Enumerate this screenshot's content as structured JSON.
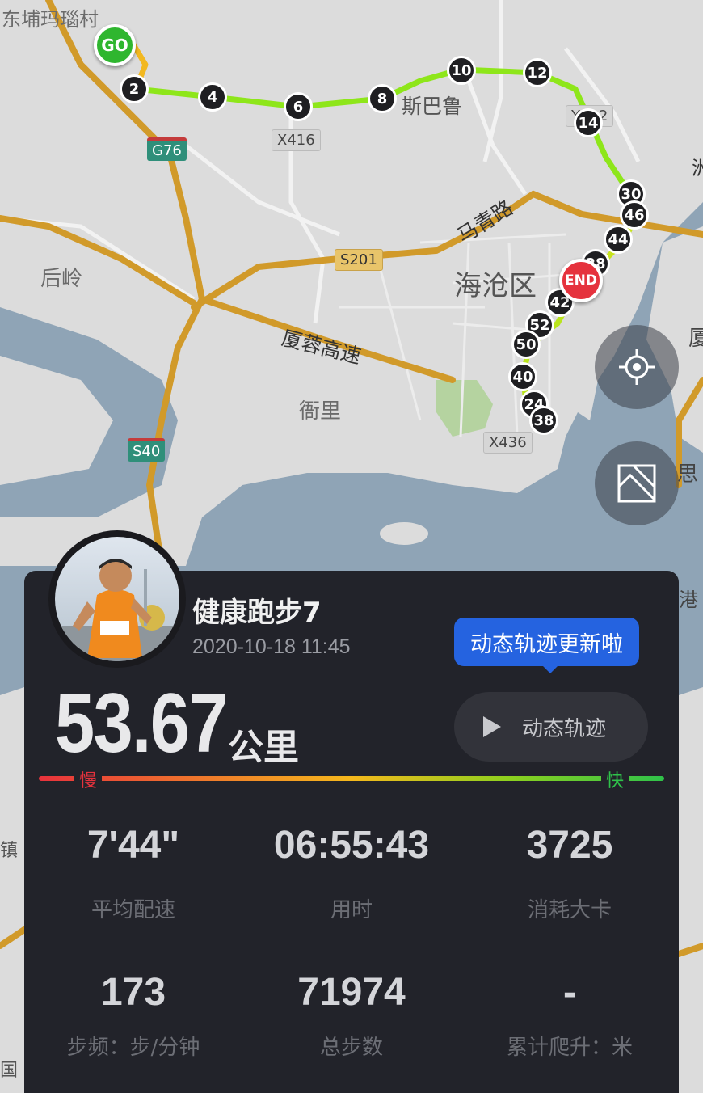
{
  "map": {
    "labels": {
      "top_left_village": "东埔玛瑙村",
      "houling": "后岭",
      "haicang": "海沧区",
      "hengli": "衙里",
      "siba": "斯巴鲁",
      "maqing_road": "马青路",
      "xiarong_expressway": "厦蓉高速",
      "edge_right_1": "洲",
      "edge_right_2": "厦",
      "edge_right_3": "思",
      "edge_right_4": "港",
      "edge_left_1": "镇",
      "edge_left_2": "国"
    },
    "road_signs": {
      "g76": "G76",
      "x416": "X416",
      "s201": "S201",
      "s40": "S40",
      "x436": "X436",
      "y012": "Y012"
    },
    "start_label": "GO",
    "end_label": "END",
    "km_markers": [
      "2",
      "4",
      "6",
      "8",
      "10",
      "12",
      "14",
      "30",
      "46",
      "44",
      "28",
      "42",
      "52",
      "50",
      "40",
      "24",
      "38"
    ],
    "locate_button_icon": "crosshair-locate-icon",
    "layer_button_icon": "map-layer-icon"
  },
  "profile": {
    "name": "健康跑步7",
    "datetime": "2020-10-18 11:45",
    "avatar_icon": "runner-avatar-photo"
  },
  "tooltip": {
    "text": "动态轨迹更新啦"
  },
  "summary": {
    "distance": "53.67",
    "distance_unit": "公里",
    "replay_label": "动态轨迹",
    "pace_slow": "慢",
    "pace_fast": "快"
  },
  "stats": [
    {
      "value": "7'44\"",
      "label": "平均配速"
    },
    {
      "value": "06:55:43",
      "label": "用时"
    },
    {
      "value": "3725",
      "label": "消耗大卡"
    },
    {
      "value": "173",
      "label": "步频：步/分钟"
    },
    {
      "value": "71974",
      "label": "总步数"
    },
    {
      "value": "-",
      "label": "累计爬升：米"
    }
  ],
  "colors": {
    "card_bg": "#22232a",
    "accent_blue": "#2563e0",
    "slow_red": "#e5323d",
    "fast_green": "#2fc24a",
    "route_green": "#7ee81a"
  }
}
